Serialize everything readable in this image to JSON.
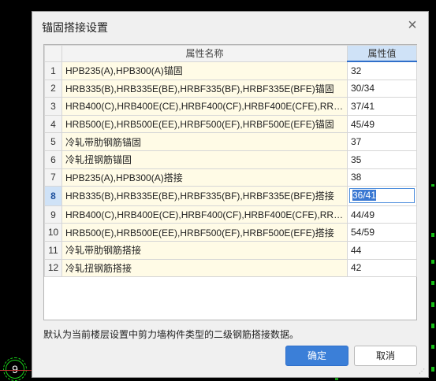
{
  "background": {
    "circle_label": "9"
  },
  "dialog": {
    "title": "锚固搭接设置",
    "close_glyph": "×",
    "table": {
      "headers": [
        "",
        "属性名称",
        "属性值"
      ],
      "rows": [
        {
          "num": "1",
          "name": "HPB235(A),HPB300(A)锚固",
          "value": "32"
        },
        {
          "num": "2",
          "name": "HRB335(B),HRB335E(BE),HRBF335(BF),HRBF335E(BFE)锚固",
          "value": "30/34"
        },
        {
          "num": "3",
          "name": "HRB400(C),HRB400E(CE),HRBF400(CF),HRBF400E(CFE),RRB4...",
          "value": "37/41"
        },
        {
          "num": "4",
          "name": "HRB500(E),HRB500E(EE),HRBF500(EF),HRBF500E(EFE)锚固",
          "value": "45/49"
        },
        {
          "num": "5",
          "name": "冷轧带肋钢筋锚固",
          "value": "37"
        },
        {
          "num": "6",
          "name": "冷轧扭钢筋锚固",
          "value": "35"
        },
        {
          "num": "7",
          "name": "HPB235(A),HPB300(A)搭接",
          "value": "38"
        },
        {
          "num": "8",
          "name": "HRB335(B),HRB335E(BE),HRBF335(BF),HRBF335E(BFE)搭接",
          "value": "36/41"
        },
        {
          "num": "9",
          "name": "HRB400(C),HRB400E(CE),HRBF400(CF),HRBF400E(CFE),RRB4...",
          "value": "44/49"
        },
        {
          "num": "10",
          "name": "HRB500(E),HRB500E(EE),HRBF500(EF),HRBF500E(EFE)搭接",
          "value": "54/59"
        },
        {
          "num": "11",
          "name": "冷轧带肋钢筋搭接",
          "value": "44"
        },
        {
          "num": "12",
          "name": "冷轧扭钢筋搭接",
          "value": "42"
        }
      ]
    },
    "hint": "默认为当前楼层设置中剪力墙构件类型的二级钢筋搭接数据。",
    "ok_label": "确定",
    "cancel_label": "取消",
    "selected_row": 8,
    "colors": {
      "accent": "#3b7fd8",
      "name_cell_bg": "#fffbe6",
      "selected_header_bg": "#cfe2f7"
    }
  }
}
